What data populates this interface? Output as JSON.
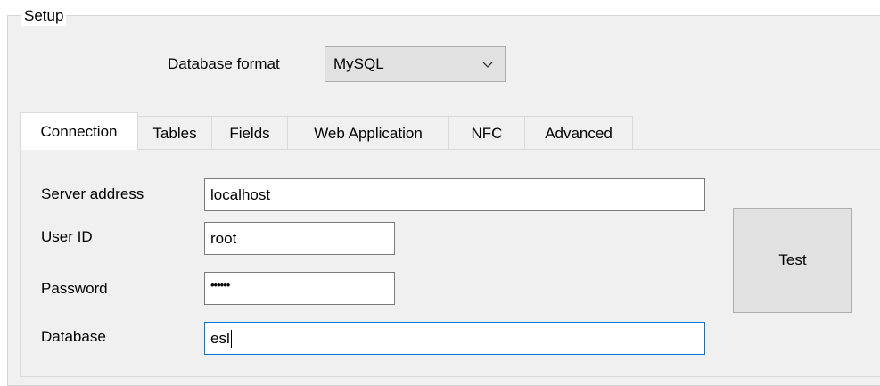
{
  "groupbox": {
    "title": "Setup"
  },
  "database_format": {
    "label": "Database format",
    "selected": "MySQL"
  },
  "tabs": [
    {
      "label": "Connection",
      "active": true
    },
    {
      "label": "Tables",
      "active": false
    },
    {
      "label": "Fields",
      "active": false
    },
    {
      "label": "Web Application",
      "active": false
    },
    {
      "label": "NFC",
      "active": false
    },
    {
      "label": "Advanced",
      "active": false
    }
  ],
  "connection": {
    "server_address": {
      "label": "Server address",
      "value": "localhost"
    },
    "user_id": {
      "label": "User ID",
      "value": "root"
    },
    "password": {
      "label": "Password",
      "masked_value": "••••••"
    },
    "database": {
      "label": "Database",
      "value": "esl"
    },
    "test_button": {
      "label": "Test"
    }
  },
  "colors": {
    "window_bg": "#f0f0f0",
    "focus_border": "#0078d7",
    "button_bg": "#e1e1e1"
  }
}
